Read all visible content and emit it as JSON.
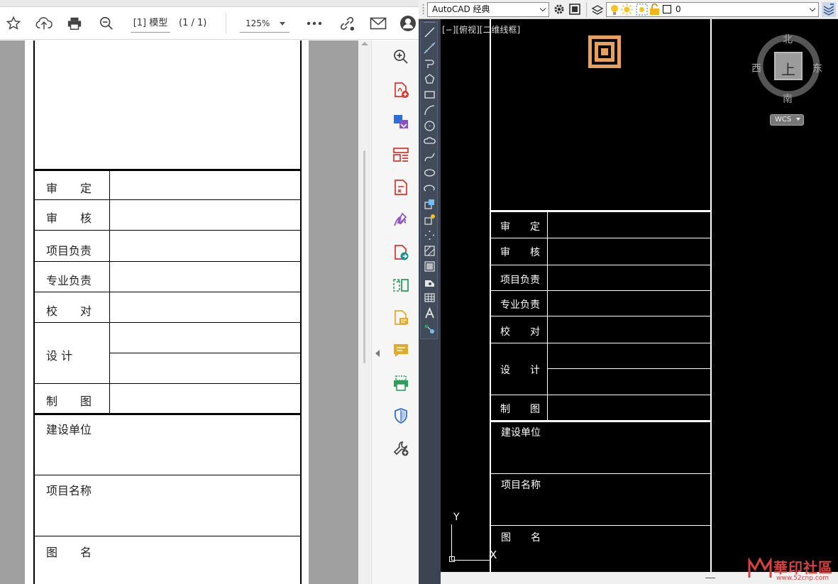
{
  "pdf": {
    "toolbar": {
      "star_icon": "star-icon",
      "upload_icon": "cloud-upload-icon",
      "print_icon": "print-icon",
      "zoom_out_icon": "zoom-out-icon",
      "model_label": "[1] 模型",
      "page_count": "(1 / 1)",
      "zoom_value": "125%",
      "more_icon": "more-icon",
      "link_icon": "link-icon",
      "mail_icon": "mail-icon",
      "account_icon": "account-icon"
    },
    "table": {
      "rows": [
        {
          "label": "审　　定"
        },
        {
          "label": "审　　核"
        },
        {
          "label": "项目负责"
        },
        {
          "label": "专业负责"
        },
        {
          "label": "校　　对"
        },
        {
          "label": "设 计"
        },
        {
          "label": "制　　图"
        }
      ],
      "sections": [
        {
          "label": "建设单位"
        },
        {
          "label": "项目名称"
        },
        {
          "label": "图　　名"
        }
      ]
    },
    "side_tools": [
      "zoom-in-icon",
      "export-pdf-icon",
      "create-pdf-icon",
      "organize-pages-icon",
      "edit-pdf-icon",
      "fill-sign-icon",
      "send-for-review-icon",
      "compare-icon",
      "export-icon",
      "comment-icon",
      "print-production-icon",
      "protect-icon",
      "more-tools-icon"
    ],
    "tool_colors": {
      "red": "#d9342b",
      "blue": "#2d6fd6",
      "purple": "#8c4fc7",
      "green": "#2e9e5b",
      "yellow": "#e3a928",
      "teal": "#1b8e8e"
    }
  },
  "cad": {
    "workspace": "AutoCAD 经典",
    "layer": "0",
    "view_label": "[−][俯视][二维线框]",
    "viewcube": {
      "north": "北",
      "south": "南",
      "east": "东",
      "west": "西",
      "top": "上",
      "wcs": "WCS"
    },
    "ucs": {
      "y": "Y",
      "x": "X"
    },
    "table": {
      "rows": [
        {
          "label": "审　　定"
        },
        {
          "label": "审　　核"
        },
        {
          "label": "项目负责"
        },
        {
          "label": "专业负责"
        },
        {
          "label": "校　　对"
        },
        {
          "label": "设　　计"
        },
        {
          "label": "制　　图"
        }
      ],
      "sections": [
        {
          "label": "建设单位"
        },
        {
          "label": "项目名称"
        },
        {
          "label": "图　　名"
        }
      ]
    },
    "accent": "#e8a05a"
  },
  "watermark": {
    "name": "華印社區",
    "url": "www.52cnp.com"
  }
}
